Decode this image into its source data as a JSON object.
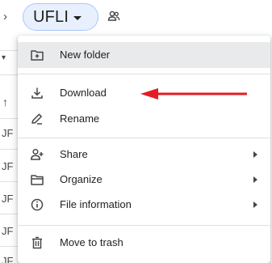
{
  "header": {
    "breadcrumb_separator": "›",
    "folder_name": "UFLI",
    "icons": {
      "dropdown": "chevron-down-icon",
      "shared": "people-icon"
    }
  },
  "background_list": {
    "rows": [
      "JF",
      "JF",
      "JF",
      "JF",
      "JF"
    ],
    "sort_icon": "arrow-up-icon",
    "filter_icon": "chevron-down-icon"
  },
  "context_menu": {
    "items": [
      {
        "label": "New folder",
        "icon": "new-folder-icon",
        "has_submenu": false,
        "highlighted": true
      },
      {
        "label": "Download",
        "icon": "download-icon",
        "has_submenu": false,
        "highlighted": false
      },
      {
        "label": "Rename",
        "icon": "pencil-icon",
        "has_submenu": false,
        "highlighted": false
      },
      {
        "label": "Share",
        "icon": "person-add-icon",
        "has_submenu": true,
        "highlighted": false
      },
      {
        "label": "Organize",
        "icon": "folder-icon",
        "has_submenu": true,
        "highlighted": false
      },
      {
        "label": "File information",
        "icon": "info-icon",
        "has_submenu": true,
        "highlighted": false
      },
      {
        "label": "Move to trash",
        "icon": "trash-icon",
        "has_submenu": false,
        "highlighted": false
      }
    ]
  },
  "annotation": {
    "color": "#e51c23",
    "target": "Download"
  },
  "colors": {
    "pill_bg": "#e8f0fe",
    "pill_border": "#a8c7fa",
    "highlight_bg": "#e9eaec",
    "icon": "#444746",
    "text": "#1f1f1f"
  }
}
